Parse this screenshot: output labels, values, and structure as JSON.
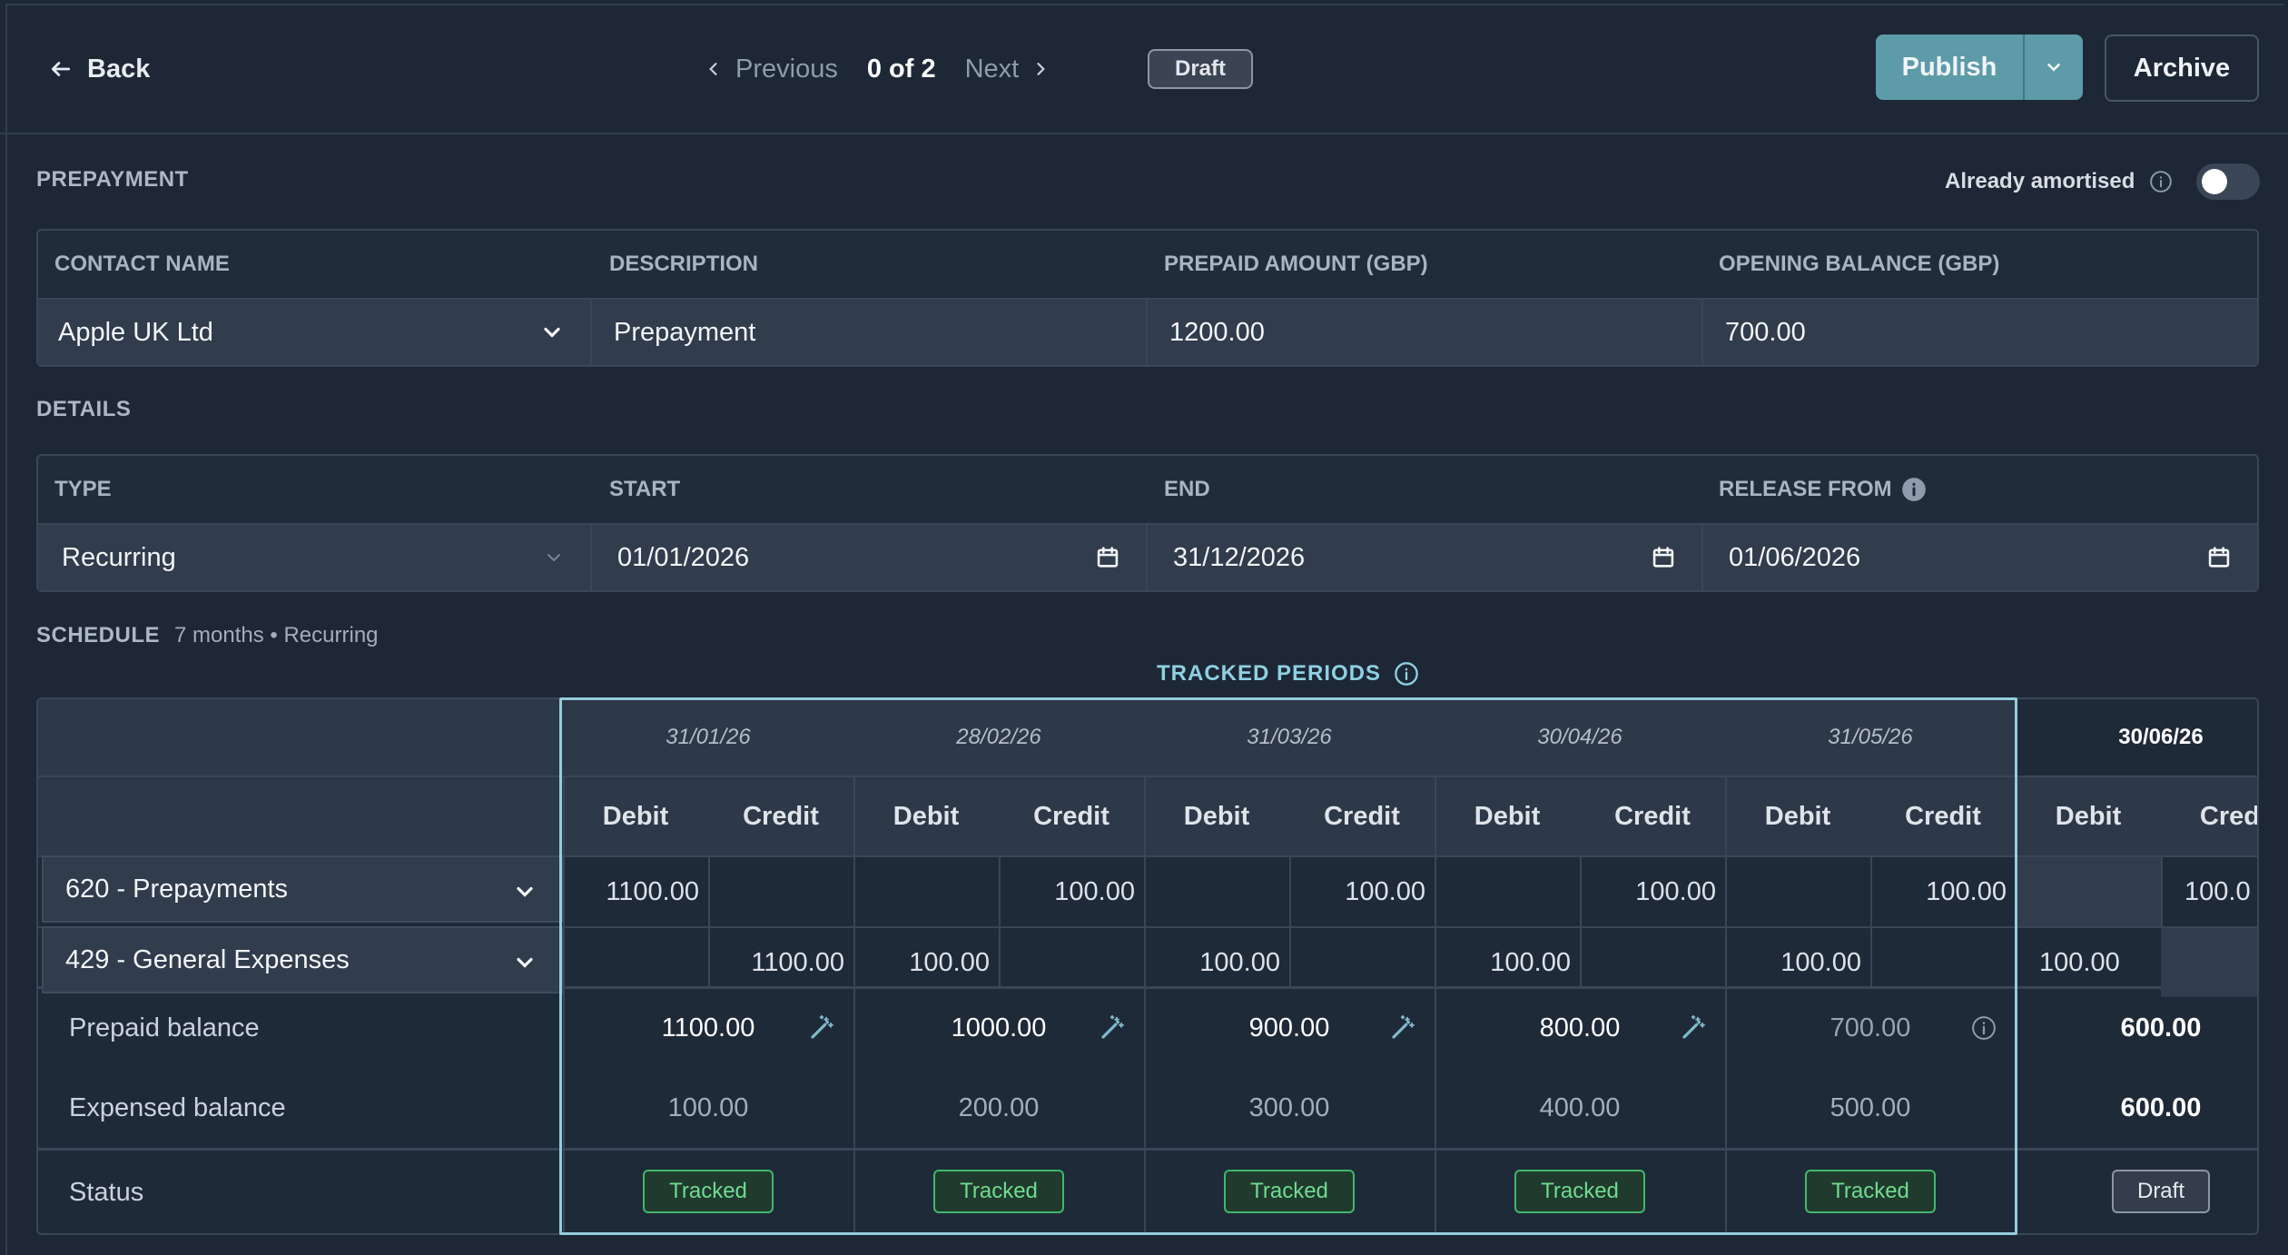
{
  "topbar": {
    "back_label": "Back",
    "prev_label": "Previous",
    "count": "0 of 2",
    "next_label": "Next",
    "status": "Draft",
    "publish_label": "Publish",
    "archive_label": "Archive"
  },
  "prepayment": {
    "section_label": "PREPAYMENT",
    "already_amortised_label": "Already amortised",
    "already_amortised_on": false,
    "headers": [
      "CONTACT NAME",
      "DESCRIPTION",
      "PREPAID AMOUNT (GBP)",
      "OPENING BALANCE (GBP)"
    ],
    "contact_name": "Apple UK Ltd",
    "description": "Prepayment",
    "prepaid_amount": "1200.00",
    "opening_balance": "700.00"
  },
  "details": {
    "section_label": "DETAILS",
    "headers": [
      "TYPE",
      "START",
      "END",
      "RELEASE FROM"
    ],
    "type": "Recurring",
    "start": "01/01/2026",
    "end": "31/12/2026",
    "release_from": "01/06/2026"
  },
  "schedule": {
    "section_label": "SCHEDULE",
    "summary": "7 months • Recurring",
    "tracked_periods_label": "TRACKED PERIODS",
    "debit_label": "Debit",
    "credit_label": "Credit",
    "periods": [
      {
        "date": "31/01/26",
        "tracked": true,
        "acct620": {
          "debit": "1100.00",
          "credit": ""
        },
        "acct429": {
          "debit": "",
          "credit": "1100.00"
        },
        "prepaid": "1100.00",
        "expensed": "100.00",
        "status": "Tracked",
        "marker": "wand"
      },
      {
        "date": "28/02/26",
        "tracked": true,
        "acct620": {
          "debit": "",
          "credit": "100.00"
        },
        "acct429": {
          "debit": "100.00",
          "credit": ""
        },
        "prepaid": "1000.00",
        "expensed": "200.00",
        "status": "Tracked",
        "marker": "wand"
      },
      {
        "date": "31/03/26",
        "tracked": true,
        "acct620": {
          "debit": "",
          "credit": "100.00"
        },
        "acct429": {
          "debit": "100.00",
          "credit": ""
        },
        "prepaid": "900.00",
        "expensed": "300.00",
        "status": "Tracked",
        "marker": "wand"
      },
      {
        "date": "30/04/26",
        "tracked": true,
        "acct620": {
          "debit": "",
          "credit": "100.00"
        },
        "acct429": {
          "debit": "100.00",
          "credit": ""
        },
        "prepaid": "800.00",
        "expensed": "400.00",
        "status": "Tracked",
        "marker": "wand"
      },
      {
        "date": "31/05/26",
        "tracked": true,
        "acct620": {
          "debit": "",
          "credit": "100.00"
        },
        "acct429": {
          "debit": "100.00",
          "credit": ""
        },
        "prepaid": "700.00",
        "expensed": "500.00",
        "status": "Tracked",
        "marker": "info"
      },
      {
        "date": "30/06/26",
        "tracked": false,
        "acct620": {
          "debit": "",
          "credit": "100.0"
        },
        "acct429": {
          "debit": "100.00",
          "credit": ""
        },
        "prepaid": "600.00",
        "expensed": "600.00",
        "status": "Draft",
        "marker": ""
      }
    ],
    "last_credit_label": "Credi",
    "accounts": [
      "620 - Prepayments",
      "429 - General Expenses"
    ],
    "row_labels": {
      "prepaid": "Prepaid balance",
      "expensed": "Expensed balance",
      "status": "Status"
    }
  },
  "colors": {
    "accent": "#5d9ba8",
    "tracked_border": "#93cddc",
    "tracked_badge": "#41b86a"
  }
}
